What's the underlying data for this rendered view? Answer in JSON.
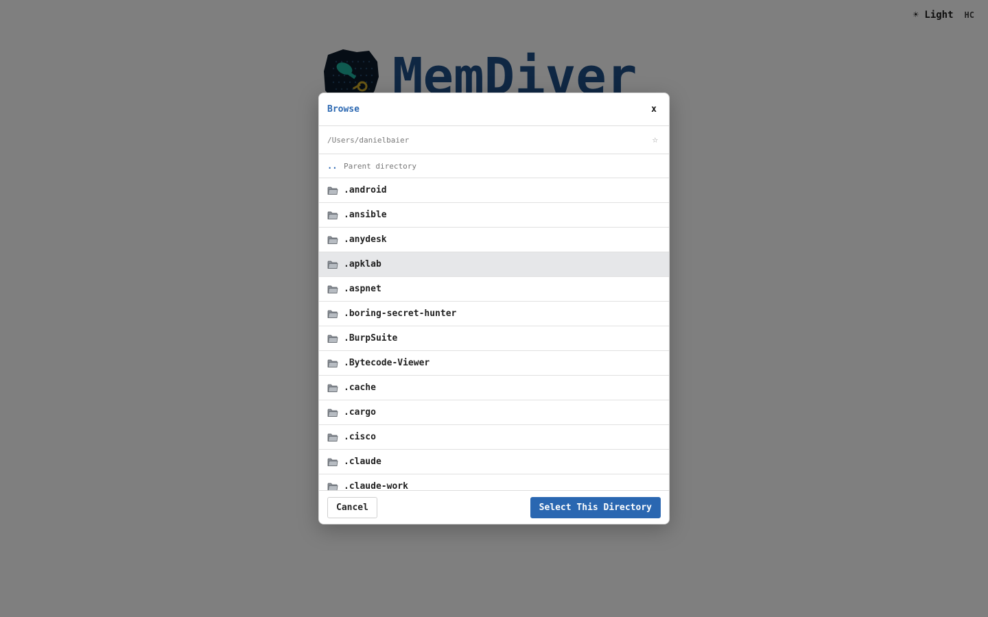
{
  "topbar": {
    "theme_label": "☀ Light",
    "hc_label": "HC"
  },
  "brand": {
    "title": "MemDiver",
    "logo_icon": "diver-key-logo"
  },
  "modal": {
    "title": "Browse",
    "close_label": "x",
    "path": "/Users/danielbaier",
    "star_icon": "☆",
    "parent": {
      "dots": "..",
      "label": "Parent directory"
    },
    "directories": [
      {
        "name": ".android"
      },
      {
        "name": ".ansible"
      },
      {
        "name": ".anydesk"
      },
      {
        "name": ".apklab"
      },
      {
        "name": ".aspnet"
      },
      {
        "name": ".boring-secret-hunter"
      },
      {
        "name": ".BurpSuite"
      },
      {
        "name": ".Bytecode-Viewer"
      },
      {
        "name": ".cache"
      },
      {
        "name": ".cargo"
      },
      {
        "name": ".cisco"
      },
      {
        "name": ".claude"
      },
      {
        "name": ".claude-work"
      }
    ],
    "highlighted_index": 3,
    "cancel_label": "Cancel",
    "select_label": "Select This Directory"
  },
  "colors": {
    "accent": "#2a67b1",
    "brand": "#1f4f86",
    "overlay": "rgba(0,0,0,0.5)",
    "highlight_row": "#e6e7e9"
  }
}
